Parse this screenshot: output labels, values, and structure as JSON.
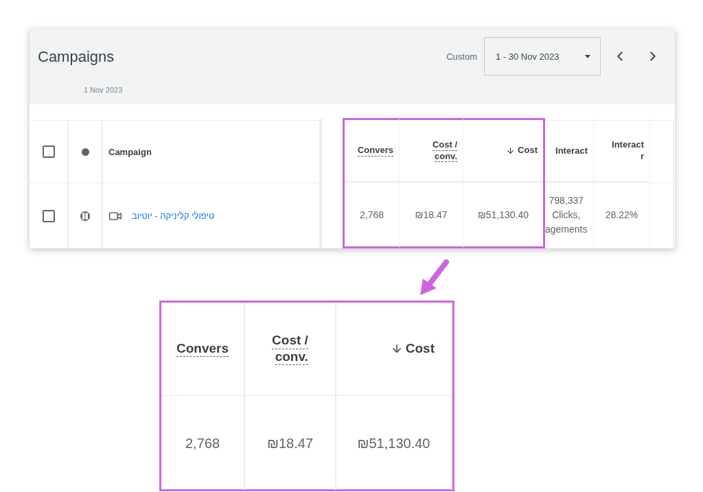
{
  "header": {
    "title": "Campaigns",
    "date_label": "1 Nov 2023",
    "range_label": "Custom",
    "date_range": "1 - 30 Nov 2023"
  },
  "table": {
    "header_checked": false,
    "campaign_heading": "Campaign",
    "columns": [
      {
        "lines": [
          "Convers"
        ],
        "hint": true,
        "sorted": false,
        "highlighted": true
      },
      {
        "lines": [
          "Cost /",
          "conv."
        ],
        "hint": true,
        "sorted": false,
        "highlighted": true
      },
      {
        "lines": [
          "Cost"
        ],
        "hint": false,
        "sorted": true,
        "highlighted": true
      },
      {
        "lines": [
          "Interact"
        ],
        "hint": false,
        "sorted": false,
        "highlighted": false
      },
      {
        "lines": [
          "Interact",
          "r"
        ],
        "hint": false,
        "sorted": false,
        "highlighted": false
      }
    ],
    "rows": [
      {
        "checked": false,
        "paused": true,
        "kind": "video",
        "name": "טיפולי קליניקה - יוטיוב",
        "values": [
          [
            "2,768"
          ],
          [
            "₪18.47"
          ],
          [
            "₪51,130.40"
          ],
          [
            "798,337",
            "Clicks,",
            "agements"
          ],
          [
            "28.22%"
          ]
        ]
      }
    ]
  },
  "callout": {
    "columns": [
      {
        "lines": [
          "Convers"
        ],
        "hint": true,
        "sorted": false
      },
      {
        "lines": [
          "Cost /",
          "conv."
        ],
        "hint": true,
        "sorted": false
      },
      {
        "lines": [
          "Cost"
        ],
        "hint": false,
        "sorted": true
      }
    ],
    "values": [
      "2,768",
      "₪18.47",
      "₪51,130.40"
    ]
  }
}
